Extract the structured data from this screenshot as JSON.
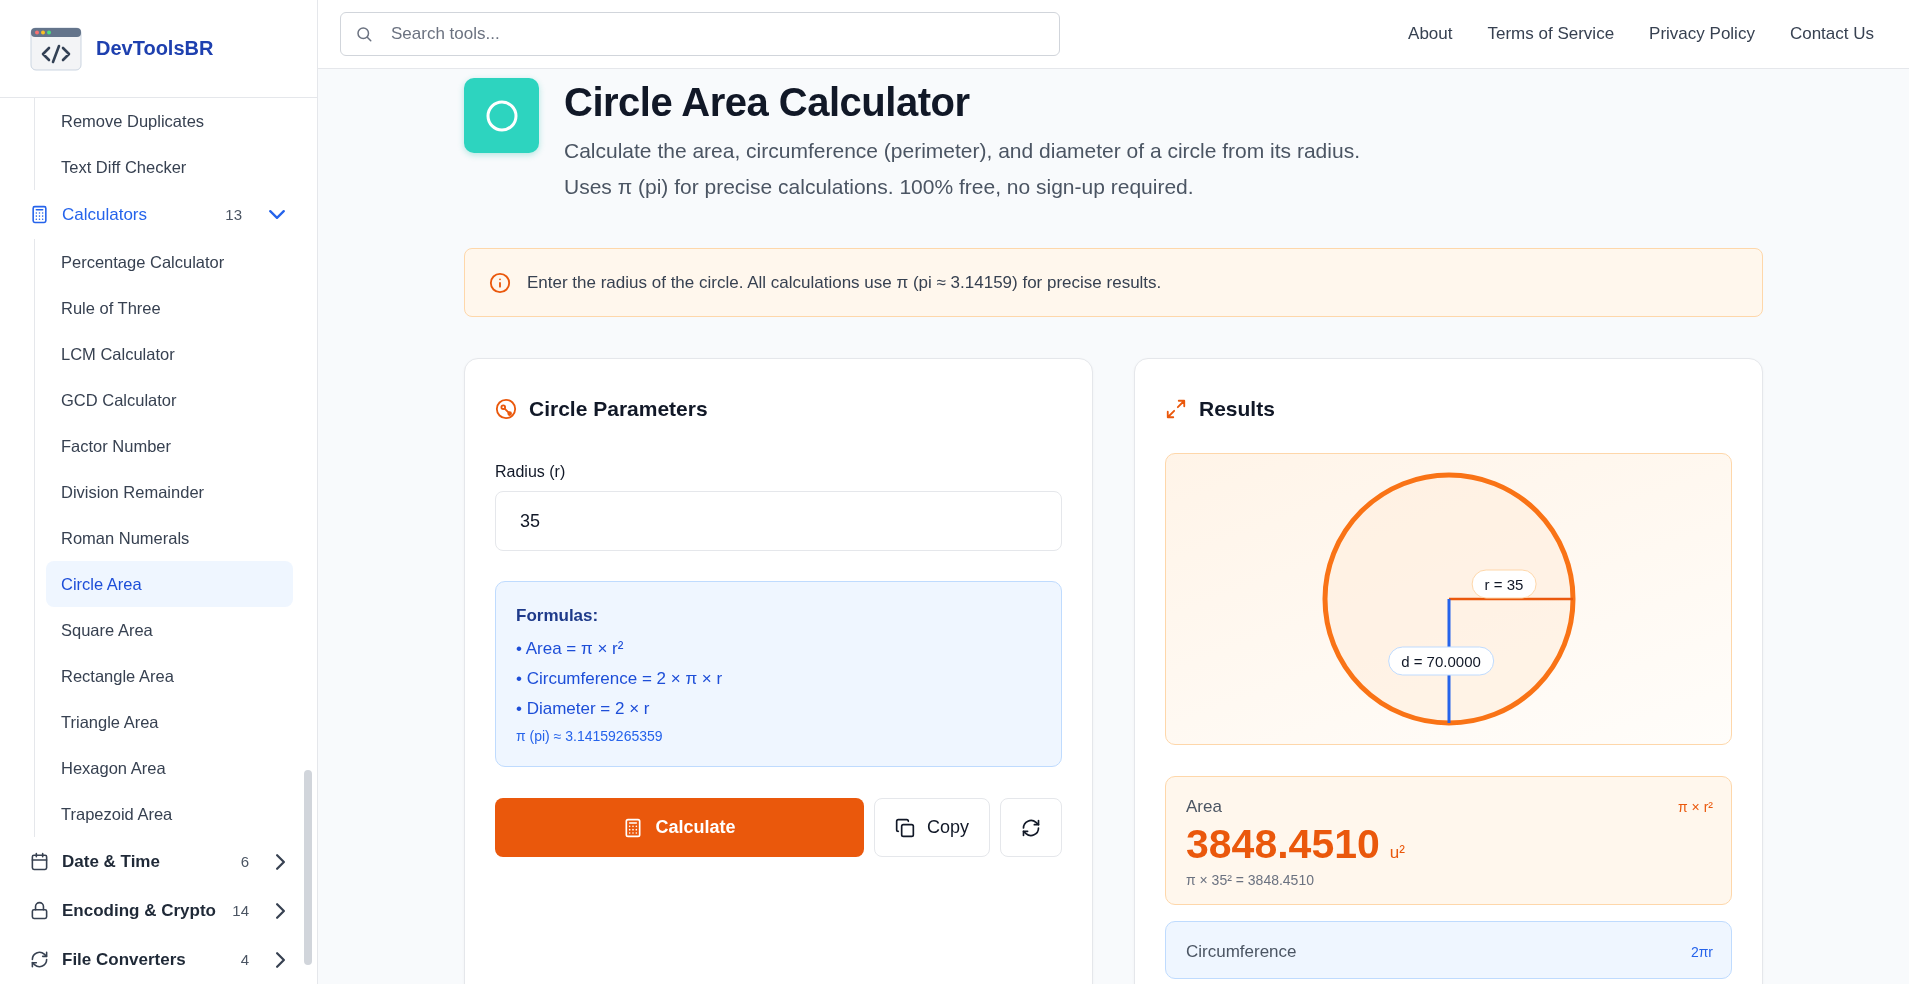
{
  "brand": {
    "name": "DevToolsBR"
  },
  "sidebar": {
    "items": [
      {
        "label": "Remove Duplicates",
        "selected": false
      },
      {
        "label": "Text Diff Checker",
        "selected": false
      }
    ],
    "groups": [
      {
        "label": "Calculators",
        "count": "13",
        "expanded": true,
        "children": [
          {
            "label": "Percentage Calculator",
            "selected": false
          },
          {
            "label": "Rule of Three",
            "selected": false
          },
          {
            "label": "LCM Calculator",
            "selected": false
          },
          {
            "label": "GCD Calculator",
            "selected": false
          },
          {
            "label": "Factor Number",
            "selected": false
          },
          {
            "label": "Division Remainder",
            "selected": false
          },
          {
            "label": "Roman Numerals",
            "selected": false
          },
          {
            "label": "Circle Area",
            "selected": true
          },
          {
            "label": "Square Area",
            "selected": false
          },
          {
            "label": "Rectangle Area",
            "selected": false
          },
          {
            "label": "Triangle Area",
            "selected": false
          },
          {
            "label": "Hexagon Area",
            "selected": false
          },
          {
            "label": "Trapezoid Area",
            "selected": false
          }
        ]
      },
      {
        "label": "Date & Time",
        "count": "6",
        "expanded": false
      },
      {
        "label": "Encoding & Crypto",
        "count": "14",
        "expanded": false
      },
      {
        "label": "File Converters",
        "count": "4",
        "expanded": false
      }
    ]
  },
  "search": {
    "placeholder": "Search tools..."
  },
  "nav_links": [
    "About",
    "Terms of Service",
    "Privacy Policy",
    "Contact Us"
  ],
  "hero": {
    "title": "Circle Area Calculator",
    "description_lines": [
      "Calculate the area, circumference (perimeter), and diameter of a circle from its radius.",
      "Uses π (pi) for precise calculations. 100% free, no sign-up required."
    ]
  },
  "info_banner": {
    "text": "Enter the radius of the circle. All calculations use π (pi ≈ 3.14159) for precise results."
  },
  "parameters": {
    "title": "Circle Parameters",
    "radius": {
      "label": "Radius (r)",
      "value": "35"
    },
    "formulas": {
      "title": "Formulas:",
      "lines": [
        "• Area = π × r²",
        "• Circumference = 2 × π × r",
        "• Diameter = 2 × r"
      ],
      "pi_note": "π (pi) ≈ 3.14159265359"
    },
    "buttons": [
      {
        "kind": "primary",
        "label": "Calculate"
      },
      {
        "kind": "secondary",
        "label": "Copy"
      },
      {
        "kind": "icon"
      }
    ]
  },
  "results": {
    "title": "Results",
    "diagram": {
      "radius_label": "r = 35",
      "diameter_label": "d = 70.0000"
    },
    "metrics": [
      {
        "kind": "area",
        "label": "Area",
        "formula": "π × r²",
        "value": "3848.4510",
        "unit": "u²",
        "expression": "π × 35² = 3848.4510"
      },
      {
        "kind": "circumference",
        "label": "Circumference",
        "formula": "2πr"
      }
    ]
  }
}
